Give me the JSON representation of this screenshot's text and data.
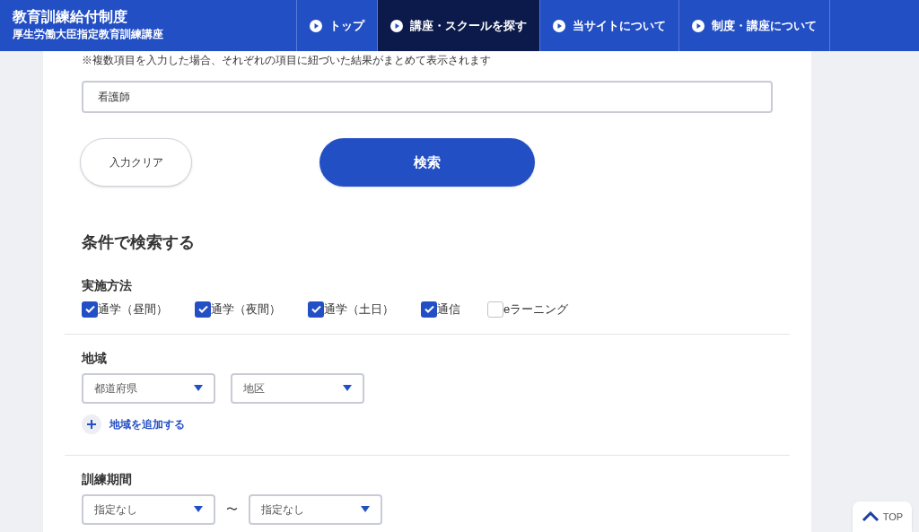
{
  "header": {
    "title": "教育訓練給付制度",
    "subtitle": "厚生労働大臣指定教育訓練講座"
  },
  "nav": [
    {
      "label": "トップ",
      "selected": false
    },
    {
      "label": "講座・スクールを探す",
      "selected": true
    },
    {
      "label": "当サイトについて",
      "selected": false
    },
    {
      "label": "制度・講座について",
      "selected": false
    }
  ],
  "note": "※複数項目を入力した場合、それぞれの項目に紐づいた結果がまとめて表示されます",
  "keyword_field": {
    "value": "看護師"
  },
  "clear_button": "入力クリア",
  "search_button": "検索",
  "conditions_heading": "条件で検索する",
  "method": {
    "label": "実施方法",
    "options": [
      {
        "label": "通学（昼間）",
        "checked": true
      },
      {
        "label": "通学（夜間）",
        "checked": true
      },
      {
        "label": "通学（土日）",
        "checked": true
      },
      {
        "label": "通信",
        "checked": true
      },
      {
        "label": "eラーニング",
        "checked": false
      }
    ]
  },
  "region": {
    "label": "地域",
    "selects": [
      "都道府県",
      "地区"
    ],
    "add_link": "地域を追加する"
  },
  "period": {
    "label": "訓練期間",
    "from": "指定なし",
    "separator": "〜",
    "to": "指定なし"
  },
  "top_button": "TOP"
}
